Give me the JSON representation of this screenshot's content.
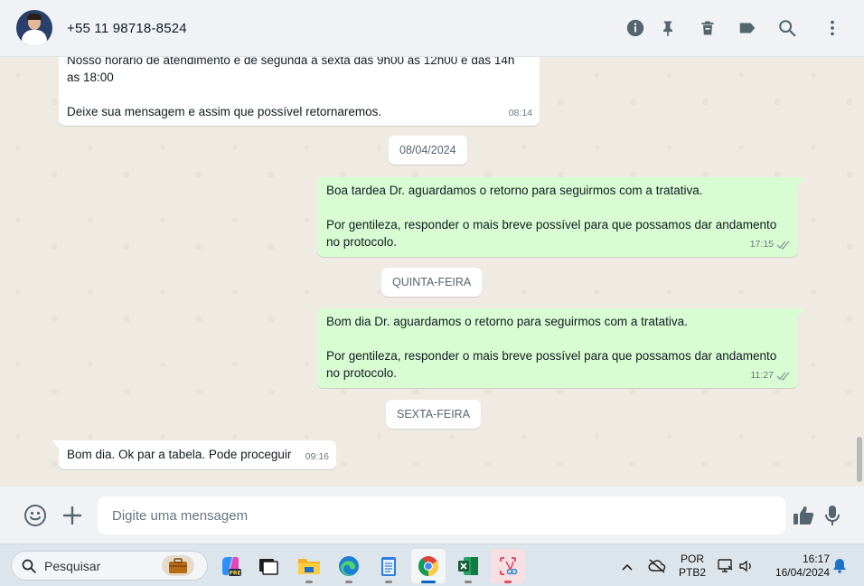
{
  "header": {
    "contact_name": "+55 11 98718-8524",
    "icons": [
      "info-icon",
      "pin-icon",
      "trash-icon",
      "label-icon",
      "search-icon",
      "more-vertical-icon"
    ]
  },
  "messages": [
    {
      "direction": "in",
      "text": "Nosso horário de atendimento é de segunda a sexta das 9h00 às 12h00 e das 14h\nas 18:00\n\nDeixe sua mensagem e assim que possível retornaremos.",
      "time": "08:14"
    },
    {
      "type": "date",
      "label": "08/04/2024"
    },
    {
      "direction": "out",
      "text": "Boa tardea Dr. aguardamos o retorno para seguirmos com a tratativa.\n\nPor gentileza, responder o mais breve possível para que possamos dar andamento\nno protocolo.",
      "time": "17:15",
      "status": "read"
    },
    {
      "type": "date",
      "label": "QUINTA-FEIRA"
    },
    {
      "direction": "out",
      "text": "Bom dia Dr. aguardamos o retorno para seguirmos com a tratativa.\n\nPor gentileza, responder o mais breve possível para que possamos dar andamento\nno protocolo.",
      "time": "11:27",
      "status": "read"
    },
    {
      "type": "date",
      "label": "SEXTA-FEIRA"
    },
    {
      "direction": "in",
      "text": "Bom dia. Ok par a tabela. Pode proceguir",
      "time": "09:16"
    }
  ],
  "composer": {
    "placeholder": "Digite uma mensagem",
    "icons": [
      "emoji-icon",
      "plus-icon",
      "thumbs-up-icon",
      "microphone-icon"
    ]
  },
  "taskbar": {
    "search_placeholder": "Pesquisar",
    "apps": [
      "work-briefcase-icon",
      "copilot-pre-icon",
      "task-view-icon",
      "file-explorer-icon",
      "edge-icon",
      "notepad-icon",
      "chrome-icon",
      "excel-icon",
      "snipping-tool-icon"
    ],
    "active_app": "chrome-icon",
    "language": "POR",
    "keyboard": "PTB2",
    "time": "16:17",
    "date": "16/04/2024"
  },
  "colors": {
    "header_bg": "#f0f2f5",
    "chat_bg": "#efeae2",
    "outgoing_bubble": "#d9fdd3",
    "incoming_bubble": "#ffffff",
    "read_ticks": "#667781",
    "taskbar_bg": "#dde5ec"
  }
}
